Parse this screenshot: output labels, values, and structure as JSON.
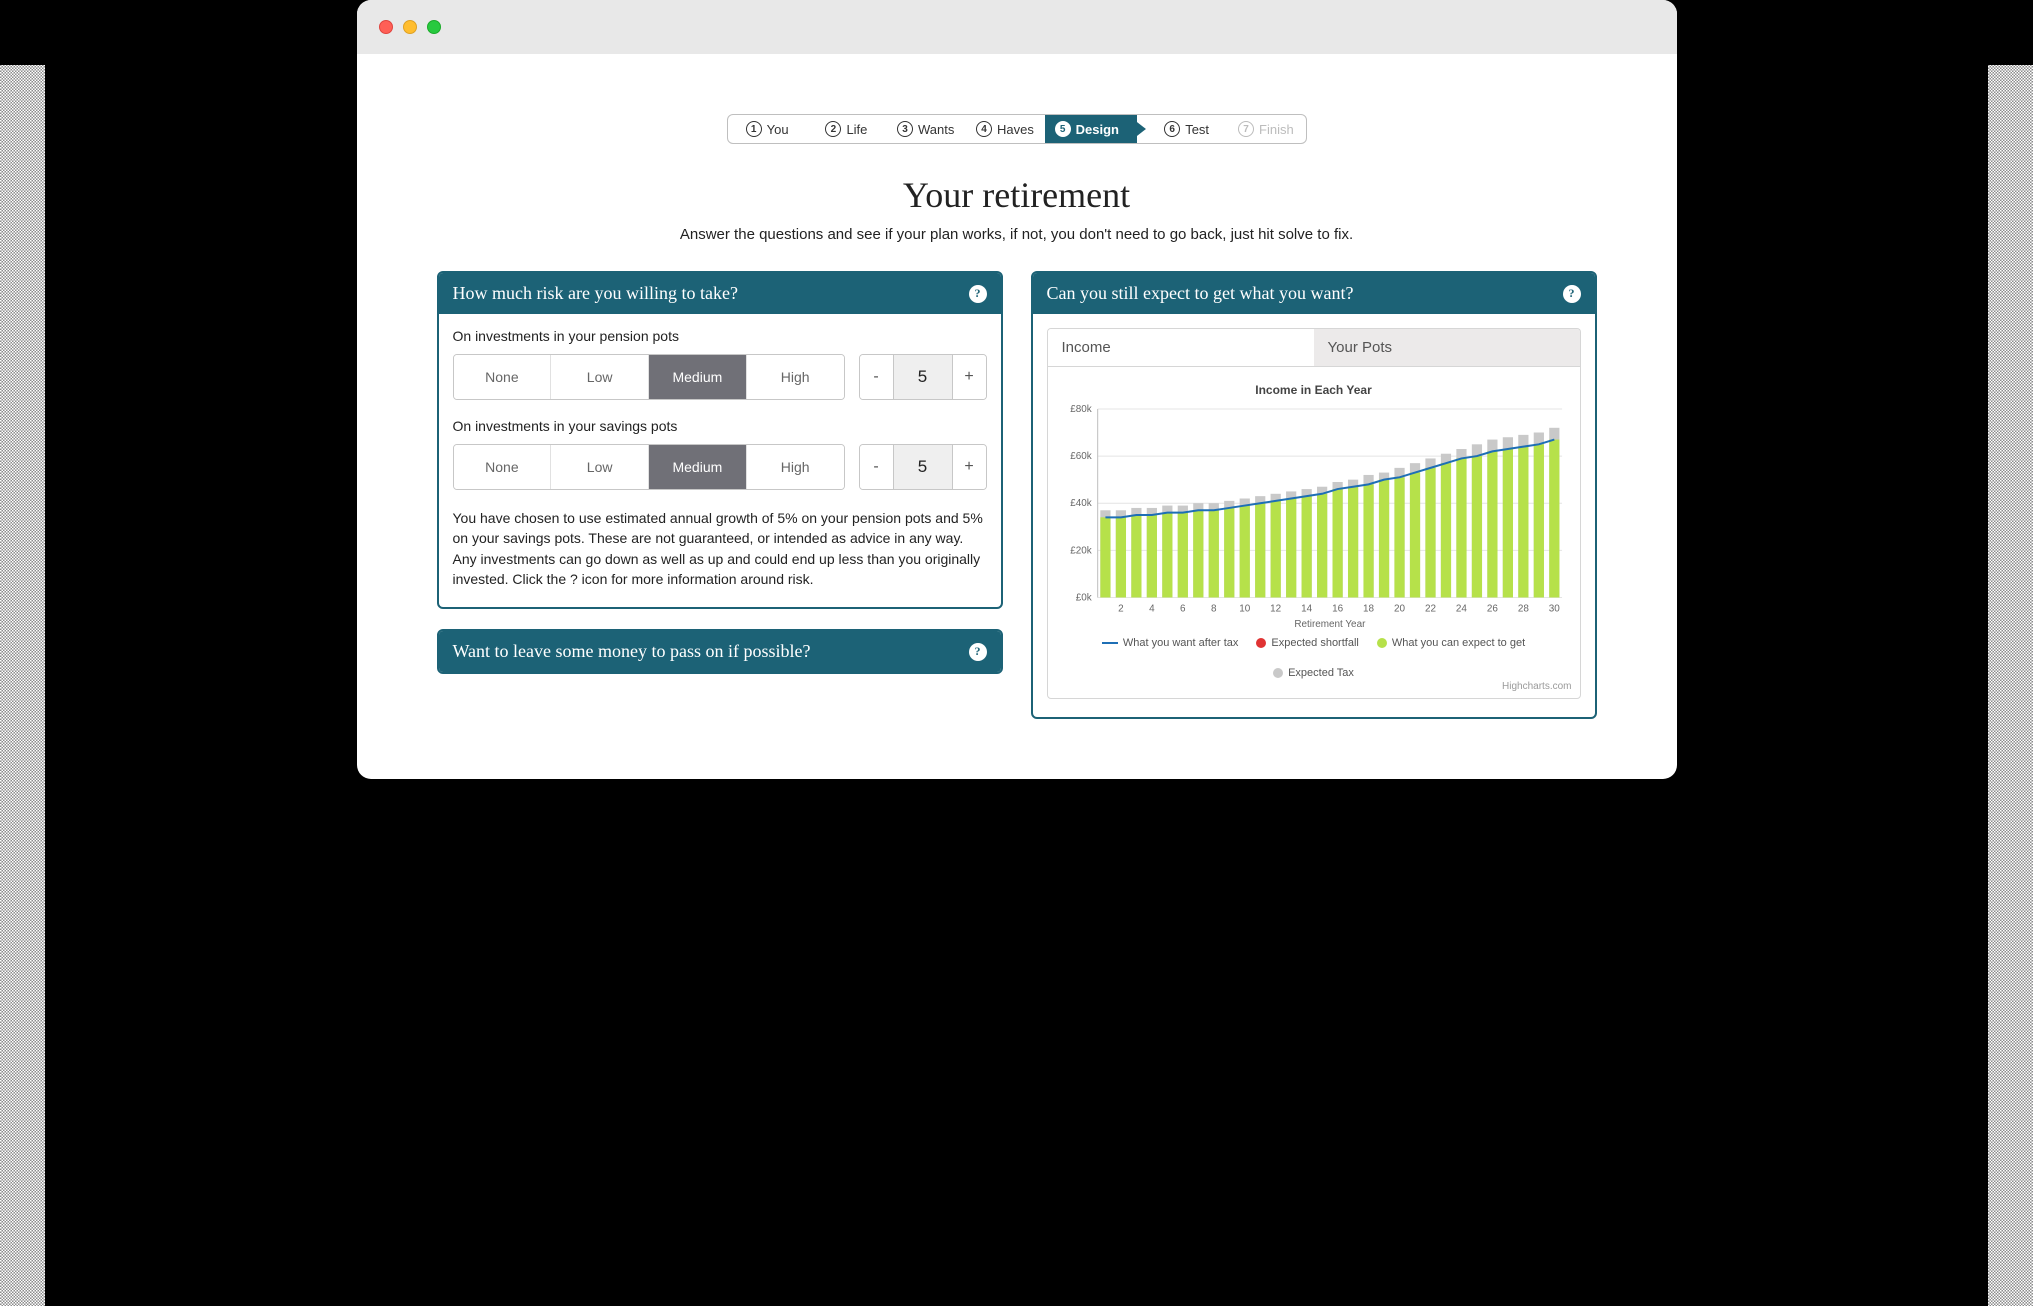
{
  "colors": {
    "teal": "#1c6276",
    "green": "#b6e14a",
    "grey": "#c9c9c9",
    "red": "#e03333",
    "blue": "#1e6fb5"
  },
  "steps": [
    {
      "num": "1",
      "label": "You"
    },
    {
      "num": "2",
      "label": "Life"
    },
    {
      "num": "3",
      "label": "Wants"
    },
    {
      "num": "4",
      "label": "Haves"
    },
    {
      "num": "5",
      "label": "Design",
      "active": true
    },
    {
      "num": "6",
      "label": "Test"
    },
    {
      "num": "7",
      "label": "Finish",
      "disabled": true
    }
  ],
  "title": "Your retirement",
  "subtitle": "Answer the questions and see if your plan works, if not, you don't need to go back, just hit solve to fix.",
  "risk": {
    "heading": "How much risk are you willing to take?",
    "groups": [
      {
        "label": "On investments in your pension pots",
        "options": [
          "None",
          "Low",
          "Medium",
          "High"
        ],
        "selected": "Medium",
        "value": "5"
      },
      {
        "label": "On investments in your savings pots",
        "options": [
          "None",
          "Low",
          "Medium",
          "High"
        ],
        "selected": "Medium",
        "value": "5"
      }
    ],
    "disclaimer": "You have chosen to use estimated annual growth of 5% on your pension pots and 5% on your savings pots. These are not guaranteed, or intended as advice in any way. Any investments can go down as well as up and could end up less than you originally invested. Click the ? icon for more information around risk."
  },
  "legacy": {
    "heading": "Want to leave some money to pass on if possible?"
  },
  "expect": {
    "heading": "Can you still expect to get what you want?",
    "tabs": [
      "Income",
      "Your Pots"
    ],
    "active_tab": "Income"
  },
  "chart_data": {
    "type": "bar",
    "title": "Income in Each Year",
    "xlabel": "Retirement Year",
    "ylabel": "",
    "ylim": [
      0,
      80
    ],
    "yticks": [
      "£0k",
      "£20k",
      "£40k",
      "£60k",
      "£80k"
    ],
    "xticks": [
      2,
      4,
      6,
      8,
      10,
      12,
      14,
      16,
      18,
      20,
      22,
      24,
      26,
      28,
      30
    ],
    "x": [
      1,
      2,
      3,
      4,
      5,
      6,
      7,
      8,
      9,
      10,
      11,
      12,
      13,
      14,
      15,
      16,
      17,
      18,
      19,
      20,
      21,
      22,
      23,
      24,
      25,
      26,
      27,
      28,
      29,
      30
    ],
    "series": [
      {
        "name": "Expected Tax",
        "color": "#c9c9c9",
        "values": [
          37,
          37,
          38,
          38,
          39,
          39,
          40,
          40,
          41,
          42,
          43,
          44,
          45,
          46,
          47,
          49,
          50,
          52,
          53,
          55,
          57,
          59,
          61,
          63,
          65,
          67,
          68,
          69,
          70,
          72
        ]
      },
      {
        "name": "What you can expect to get",
        "color": "#b6e14a",
        "values": [
          34,
          34,
          35,
          35,
          36,
          36,
          37,
          37,
          38,
          39,
          40,
          41,
          42,
          43,
          44,
          46,
          47,
          48,
          50,
          51,
          53,
          55,
          57,
          59,
          60,
          62,
          63,
          64,
          65,
          67
        ]
      },
      {
        "name": "What you want after tax",
        "color": "#1e6fb5",
        "type": "line",
        "values": [
          34,
          34,
          35,
          35,
          36,
          36,
          37,
          37,
          38,
          39,
          40,
          41,
          42,
          43,
          44,
          46,
          47,
          48,
          50,
          51,
          53,
          55,
          57,
          59,
          60,
          62,
          63,
          64,
          65,
          67
        ]
      },
      {
        "name": "Expected shortfall",
        "color": "#e03333",
        "values": [
          0,
          0,
          0,
          0,
          0,
          0,
          0,
          0,
          0,
          0,
          0,
          0,
          0,
          0,
          0,
          0,
          0,
          0,
          0,
          0,
          0,
          0,
          0,
          0,
          0,
          0,
          0,
          0,
          0,
          0
        ]
      }
    ],
    "legend_order": [
      "What you want after tax",
      "Expected shortfall",
      "What you can expect to get",
      "Expected Tax"
    ],
    "credit": "Highcharts.com"
  }
}
